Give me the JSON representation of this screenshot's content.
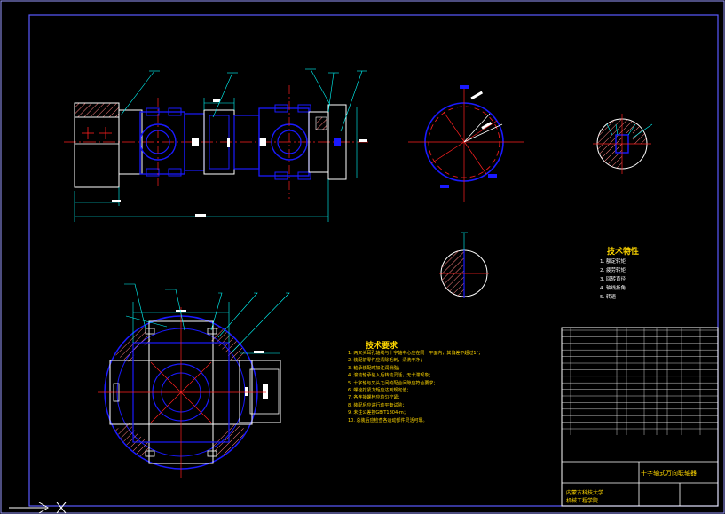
{
  "tech_req": {
    "title": "技术要求",
    "lines": [
      "1. 两叉头耳孔轴线与十字轴中心应在同一平面内，其偏差不超过1°；",
      "2. 装配前零件应清除毛刺，清洗干净；",
      "3. 轴承装配时加注润滑脂；",
      "4. 滚动轴承装入后转动灵活，无卡滞现象；",
      "5. 十字轴与叉头之间的配合间隙应符合要求；",
      "6. 螺栓拧紧力矩应达到规定值；",
      "7. 各连接螺栓应均匀拧紧；",
      "8. 装配后应进行动平衡试验；",
      "9. 未注公差按GB/T1804-m；",
      "10. 总装后应检查各运动部件灵活可靠。"
    ]
  },
  "tech_params": {
    "title": "技术特性",
    "lines": [
      "1. 额定转矩",
      "2. 疲劳转矩",
      "3. 回转直径",
      "4. 轴线折角",
      "5. 转速"
    ]
  },
  "title_block": {
    "drawing_name": "十字轴式万向联轴器",
    "unit_line1": "内蒙古科技大学",
    "unit_line2": "机械工程学院"
  },
  "colors": {
    "background": "#000000",
    "frame": "#3a3aff",
    "outline": "#ffffff",
    "part": "#1a1aff",
    "centerline": "#ff2020",
    "hatch": "#ff8080",
    "dimension": "#00ffff",
    "annotation": "#ffd700"
  }
}
